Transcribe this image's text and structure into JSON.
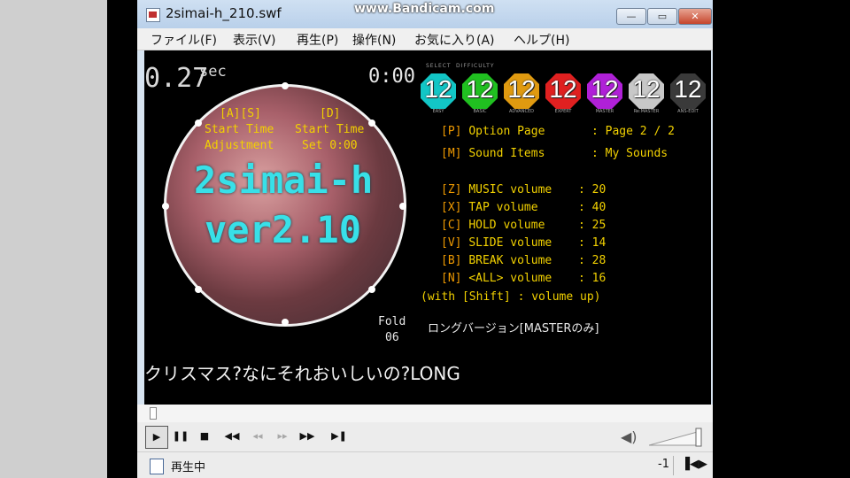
{
  "window": {
    "title": "2simai-h_210.swf",
    "watermark": "www.Bandicam.com",
    "buttons": {
      "minimize": "—",
      "maximize": "▭",
      "close": "✕"
    }
  },
  "menu": [
    "ファイル(F)",
    "表示(V)",
    "再生(P)",
    "操作(N)",
    "お気に入り(A)",
    "ヘルプ(H)"
  ],
  "game": {
    "timer_value": "0.27",
    "timer_unit": "sec",
    "clock": "0:00",
    "jacket": {
      "key_as": "[A][S]",
      "key_d": "[D]",
      "start_time_l": "Start Time",
      "start_time_r": "Start Time",
      "adjustment": "Adjustment",
      "set": "Set 0:00",
      "title_line1": "2simai-h",
      "title_line2": "ver2.10"
    },
    "difficulty_header_left": "SELECT",
    "difficulty_header_right": "DIFFICULTY",
    "difficulties": [
      {
        "level": "12",
        "label": "EASY",
        "color": "#12c6c6"
      },
      {
        "level": "12",
        "label": "BASIC",
        "color": "#20c020"
      },
      {
        "level": "12",
        "label": "ADVANCED",
        "color": "#e09a10"
      },
      {
        "level": "12",
        "label": "EXPERT",
        "color": "#e02020"
      },
      {
        "level": "12",
        "label": "MASTER",
        "color": "#b020d8"
      },
      {
        "level": "12",
        "label": "Re:MASTER",
        "color": "#c8c8c8"
      },
      {
        "level": "12",
        "label": "ANS-EDIT",
        "color": "#3a3a3a"
      }
    ],
    "options": [
      {
        "key": "[P]",
        "label": "Option Page",
        "value": ": Page 2 / 2"
      },
      {
        "key": "[M]",
        "label": "Sound Items",
        "value": ": My Sounds"
      },
      {
        "key": "[Z]",
        "label": "MUSIC volume",
        "value": ": 20"
      },
      {
        "key": "[X]",
        "label": "TAP   volume",
        "value": ": 40"
      },
      {
        "key": "[C]",
        "label": "HOLD  volume",
        "value": ": 25"
      },
      {
        "key": "[V]",
        "label": "SLIDE volume",
        "value": ": 14"
      },
      {
        "key": "[B]",
        "label": "BREAK volume",
        "value": ": 28"
      },
      {
        "key": "[N]",
        "label": "<ALL> volume",
        "value": ": 16"
      }
    ],
    "shift_note": "(with [Shift] : volume up)",
    "fold_label": "Fold",
    "fold_value": "06",
    "long_note": "ロングバージョン[MASTERのみ]",
    "song_title": "クリスマス?なにそれおいしいの?LONG"
  },
  "player": {
    "controls": [
      {
        "icon": "play-icon",
        "glyph": "▶",
        "enabled": true
      },
      {
        "icon": "pause-icon",
        "glyph": "❚❚",
        "enabled": true
      },
      {
        "icon": "stop-icon",
        "glyph": "■",
        "enabled": true
      },
      {
        "icon": "skip-back-icon",
        "glyph": "◀◀",
        "enabled": true
      },
      {
        "icon": "rewind-icon",
        "glyph": "◂◂",
        "enabled": false
      },
      {
        "icon": "fast-forward-icon",
        "glyph": "▸▸",
        "enabled": false
      },
      {
        "icon": "skip-forward-icon",
        "glyph": "▶▶",
        "enabled": true
      },
      {
        "icon": "step-forward-icon",
        "glyph": "▶❚",
        "enabled": true
      }
    ],
    "volume_glyph": "◀)",
    "status": "再生中",
    "count": "-1",
    "aspect_glyph": "▐◀▶"
  }
}
